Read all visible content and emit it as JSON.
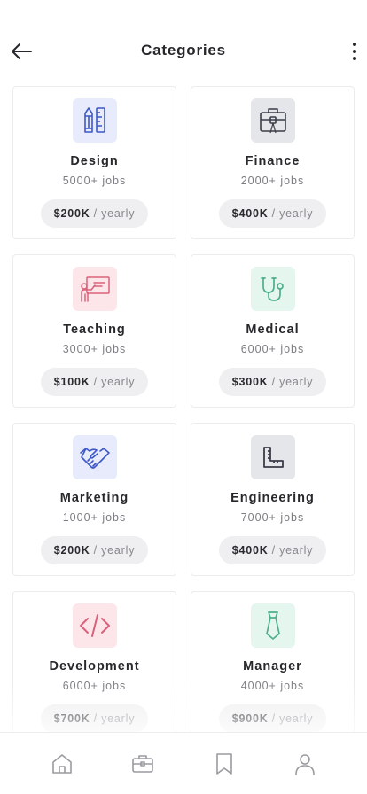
{
  "header": {
    "title": "Categories",
    "back_icon": "arrow-left-icon",
    "more_icon": "more-vertical-icon"
  },
  "categories": [
    {
      "name": "Design",
      "jobs": "5000+ jobs",
      "salary": "$200K",
      "period": "/ yearly",
      "icon": "pencil-ruler-icon",
      "icon_bg": "#e7ebfb",
      "icon_color": "#3c58c7"
    },
    {
      "name": "Finance",
      "jobs": "2000+ jobs",
      "salary": "$400K",
      "period": "/ yearly",
      "icon": "briefcase-icon",
      "icon_bg": "#e5e6ea",
      "icon_color": "#3a3d48"
    },
    {
      "name": "Teaching",
      "jobs": "3000+ jobs",
      "salary": "$100K",
      "period": "/ yearly",
      "icon": "teacher-board-icon",
      "icon_bg": "#fce6ea",
      "icon_color": "#d9627a"
    },
    {
      "name": "Medical",
      "jobs": "6000+ jobs",
      "salary": "$300K",
      "period": "/ yearly",
      "icon": "stethoscope-icon",
      "icon_bg": "#e5f6ef",
      "icon_color": "#4fae8c"
    },
    {
      "name": "Marketing",
      "jobs": "1000+ jobs",
      "salary": "$200K",
      "period": "/ yearly",
      "icon": "handshake-icon",
      "icon_bg": "#e7ebfb",
      "icon_color": "#3c58c7"
    },
    {
      "name": "Engineering",
      "jobs": "7000+ jobs",
      "salary": "$400K",
      "period": "/ yearly",
      "icon": "ruler-square-icon",
      "icon_bg": "#e5e6ea",
      "icon_color": "#3a3d48"
    },
    {
      "name": "Development",
      "jobs": "6000+ jobs",
      "salary": "$700K",
      "period": "/ yearly",
      "icon": "code-icon",
      "icon_bg": "#fce6ea",
      "icon_color": "#d9627a"
    },
    {
      "name": "Manager",
      "jobs": "4000+ jobs",
      "salary": "$900K",
      "period": "/ yearly",
      "icon": "tie-icon",
      "icon_bg": "#e5f6ef",
      "icon_color": "#4fae8c"
    }
  ],
  "bottom_nav": [
    {
      "icon": "home-icon"
    },
    {
      "icon": "briefcase-icon"
    },
    {
      "icon": "bookmark-icon"
    },
    {
      "icon": "profile-icon"
    }
  ],
  "colors": {
    "nav_icon": "#9a9ba0"
  }
}
